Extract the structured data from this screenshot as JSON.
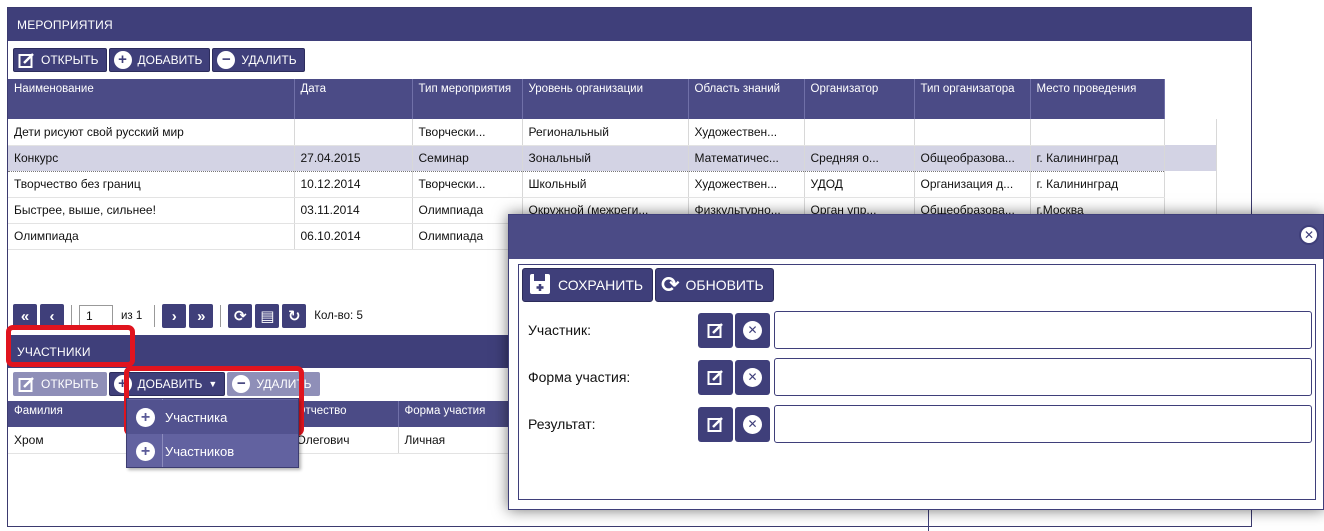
{
  "events": {
    "header": "МЕРОПРИЯТИЯ",
    "toolbar": {
      "open": "ОТКРЫТЬ",
      "add": "ДОБАВИТЬ",
      "delete": "УДАЛИТЬ"
    },
    "columns": [
      "Наименование",
      "Дата",
      "Тип мероприятия",
      "Уровень организации",
      "Область знаний",
      "Организатор",
      "Тип организатора",
      "Место проведения"
    ],
    "rows": [
      [
        "Дети рисуют свой русский мир",
        "",
        "Творчески...",
        "Региональный",
        "Художествен...",
        "",
        "",
        ""
      ],
      [
        "Конкурс",
        "27.04.2015",
        "Семинар",
        "Зональный",
        "Математичес...",
        "Средняя о...",
        "Общеобразова...",
        "г. Калининград"
      ],
      [
        "Творчество без границ",
        "10.12.2014",
        "Творчески...",
        "Школьный",
        "Художествен...",
        "УДОД",
        "Организация д...",
        "г. Калининград"
      ],
      [
        "Быстрее, выше, сильнее!",
        "03.11.2014",
        "Олимпиада",
        "Окружной (межреги...",
        "Физкультурно...",
        "Орган упр...",
        "Общеобразова...",
        "г.Москва"
      ],
      [
        "Олимпиада",
        "06.10.2014",
        "Олимпиада",
        "",
        "",
        "",
        "",
        ""
      ]
    ],
    "selected_row": 1,
    "pager": {
      "page": "1",
      "of": "из 1",
      "count": "Кол-во: 5"
    }
  },
  "participants": {
    "header": "УЧАСТНИКИ",
    "toolbar": {
      "open": "ОТКРЫТЬ",
      "add": "ДОБАВИТЬ",
      "delete": "УДАЛИТЬ"
    },
    "columns": [
      "Фамилия",
      "",
      "Отчество",
      "Форма участия"
    ],
    "rows": [
      [
        "Хром",
        "",
        "Олегович",
        "Личная"
      ]
    ],
    "add_menu": [
      "Участника",
      "Участников"
    ]
  },
  "dialog": {
    "save": "СОХРАНИТЬ",
    "refresh": "ОБНОВИТЬ",
    "fields": [
      {
        "label": "Участник:",
        "value": ""
      },
      {
        "label": "Форма участия:",
        "value": ""
      },
      {
        "label": "Результат:",
        "value": ""
      }
    ]
  },
  "colors": {
    "primary": "#3f3f7a",
    "highlight": "#e0141e"
  }
}
